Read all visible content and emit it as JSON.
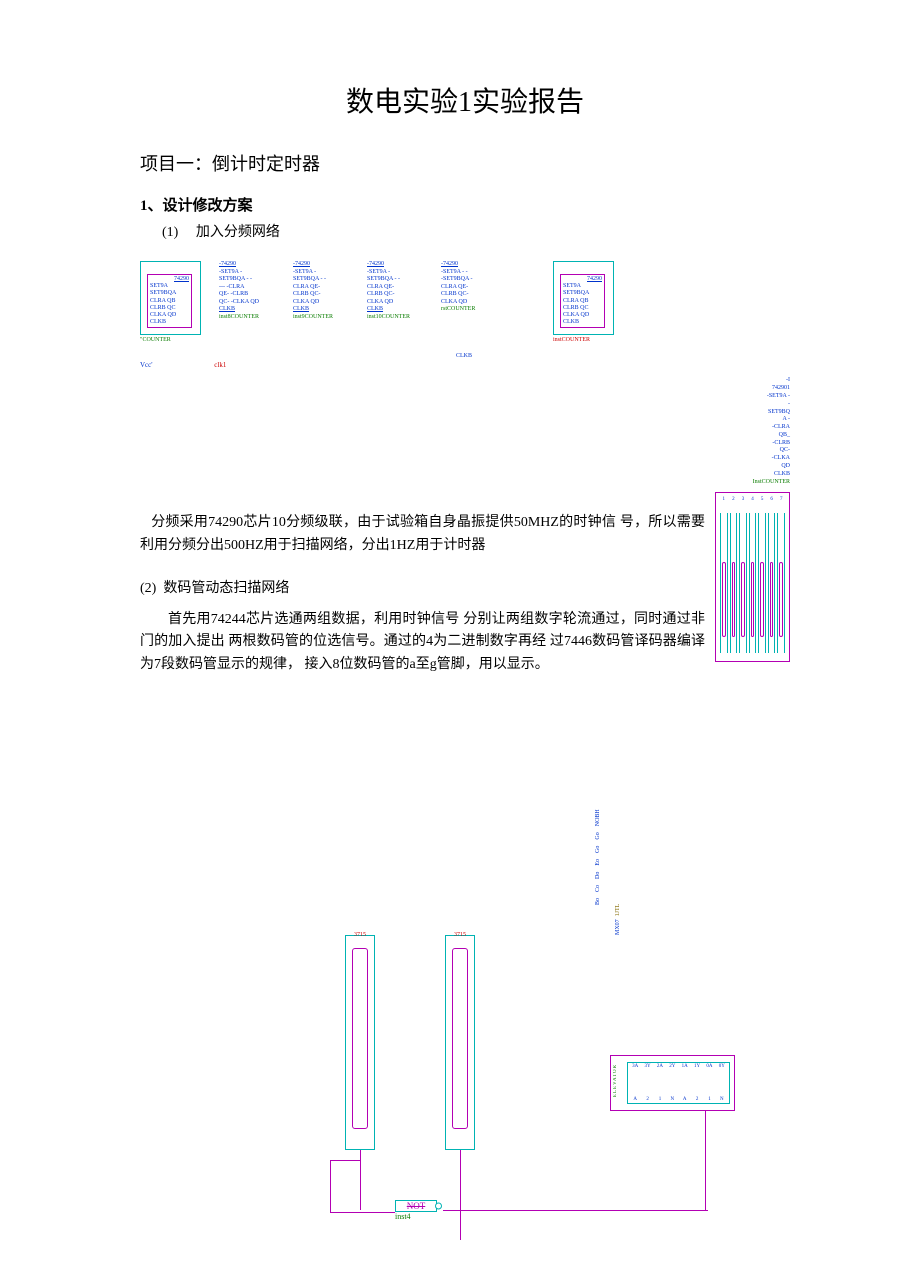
{
  "title": "数电实验1实验报告",
  "project_title": "项目一：倒计时定时器",
  "section1": {
    "num": "1、",
    "head": "设计修改方案",
    "item1_num": "(1)",
    "item1_text": "加入分频网络"
  },
  "chip_block": {
    "name": "74290",
    "rows": [
      "SET9A",
      "SET9BQA",
      "CLRA QB",
      "CLRB QC",
      "CLKA QD",
      "CLKB"
    ],
    "under_left": "\"COUNTER",
    "under_right": "instCOUNTER"
  },
  "text_blocks": [
    {
      "hd": "-74290",
      "r1": "-SET9A -",
      "r2": "SET9BQA - -",
      "r3": "---    -CLRA",
      "r4": "QE-    -CLRB",
      "r5": "QC- -CLKA QD",
      "clk": "CLKB",
      "ft": "inst8COUNTER"
    },
    {
      "hd": "-74290",
      "r1": "-SET9A -",
      "r2": "SET9BQA - -",
      "r3": "CLRA   QE-",
      "r4": "CLRB   QC-",
      "r5": "CLKA QD",
      "clk": "CLKB",
      "ft": "inst9COUNTER"
    },
    {
      "hd": "-74290",
      "r1": "-SET9A -",
      "r2": "SET9BQA - -",
      "r3": "CLRA   QE-",
      "r4": "CLRB   QC-",
      "r5": "CLKA QD",
      "clk": "CLKB",
      "ft": "inst10COUNTER"
    },
    {
      "hd": "-74290",
      "r1": "-SET9A - -",
      "r2": "-SET9BQA -",
      "r3": "CLRA QE-",
      "r4": "CLRB QC-",
      "r5": "CLKA QD",
      "clk": "rstCOUNTER",
      "ft": ""
    }
  ],
  "vcc": {
    "label": "Vcc'",
    "clk": "clk1"
  },
  "vert_chip": {
    "lines": [
      "-I",
      "742901",
      "-SET9A -",
      "-",
      "SET9BQ",
      "A -",
      "-CLRA",
      "QB_",
      "-CLRB",
      "QC-",
      "-CLKA",
      "QD",
      "CLKB"
    ],
    "ft": "InstCOUNTER"
  },
  "right_strip_nums": [
    "1",
    "2",
    "3",
    "4",
    "5",
    "6",
    "7"
  ],
  "clkb_lone": "CLKB",
  "para1": "分频采用74290芯片10分频级联，由于试验箱自身晶振提供50MHZ的时钟信   号，所以需要利用分频分出500HZ用于扫描网络，分出1HZ用于计时器",
  "item2_num": "(2)",
  "item2_text": "数码管动态扫描网络",
  "para2": "首先用74244芯片选通两组数据，利用时钟信号 分别让两组数字轮流通过，同时通过非门的加入提出 两根数码管的位选信号。通过的4为二进制数字再经   过7446数码管译码器编译为7段数码管显示的规律，    接入8位数码管的a至g管脚，用以显示。",
  "not_gate": {
    "sym": "NOT",
    "lbl": "inst4"
  },
  "right_chip": {
    "side": "ELEVATOR",
    "top": [
      "3A",
      "3Y",
      "2A",
      "2Y",
      "1A",
      "1Y",
      "0A",
      "0Y"
    ],
    "bot": [
      "A",
      "2",
      "1",
      "N",
      "A",
      "2",
      "1",
      "N"
    ]
  },
  "rot_labels": [
    "Bo",
    "Co",
    "Do",
    "Eo",
    "Go",
    "Go",
    "NOBH"
  ],
  "rot_sub": {
    "a": "MX07",
    "b": "1JTL"
  },
  "tall_top": "3715",
  "chart_data": null
}
